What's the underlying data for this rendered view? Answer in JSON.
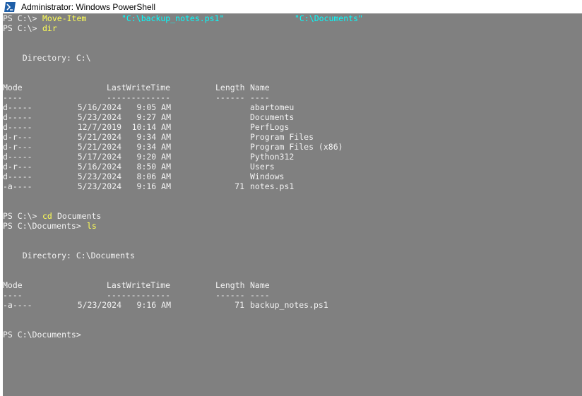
{
  "window": {
    "title": "Administrator: Windows PowerShell",
    "icon": "powershell-icon"
  },
  "colors": {
    "console_bg": "#808080",
    "text": "#f2f2f2",
    "command": "#ffff55",
    "string": "#00ffff"
  },
  "console": {
    "cmd1": {
      "prompt": "PS C:\\> ",
      "command": "Move-Item",
      "arg1": "\"C:\\backup_notes.ps1\"",
      "arg2": "\"C:\\Documents\""
    },
    "cmd2": {
      "prompt": "PS C:\\> ",
      "command": "dir"
    },
    "dir1": {
      "directory_label": "    Directory: C:\\",
      "headers": {
        "mode": "Mode",
        "lastwrite": "LastWriteTime",
        "length": "Length",
        "name": "Name"
      },
      "underline": {
        "mode": "----",
        "lastwrite": "-------------",
        "length": "------",
        "name": "----"
      },
      "rows": [
        {
          "mode": "d-----",
          "date": "5/16/2024",
          "time": "9:05 AM",
          "length": "",
          "name": "abartomeu"
        },
        {
          "mode": "d-----",
          "date": "5/23/2024",
          "time": "9:27 AM",
          "length": "",
          "name": "Documents"
        },
        {
          "mode": "d-----",
          "date": "12/7/2019",
          "time": "10:14 AM",
          "length": "",
          "name": "PerfLogs"
        },
        {
          "mode": "d-r---",
          "date": "5/21/2024",
          "time": "9:34 AM",
          "length": "",
          "name": "Program Files"
        },
        {
          "mode": "d-r---",
          "date": "5/21/2024",
          "time": "9:34 AM",
          "length": "",
          "name": "Program Files (x86)"
        },
        {
          "mode": "d-----",
          "date": "5/17/2024",
          "time": "9:20 AM",
          "length": "",
          "name": "Python312"
        },
        {
          "mode": "d-r---",
          "date": "5/16/2024",
          "time": "8:50 AM",
          "length": "",
          "name": "Users"
        },
        {
          "mode": "d-----",
          "date": "5/23/2024",
          "time": "8:06 AM",
          "length": "",
          "name": "Windows"
        },
        {
          "mode": "-a----",
          "date": "5/23/2024",
          "time": "9:16 AM",
          "length": "71",
          "name": "notes.ps1"
        }
      ]
    },
    "cmd3": {
      "prompt": "PS C:\\> ",
      "command": "cd",
      "arg": "Documents"
    },
    "cmd4": {
      "prompt": "PS C:\\Documents> ",
      "command": "ls"
    },
    "dir2": {
      "directory_label": "    Directory: C:\\Documents",
      "headers": {
        "mode": "Mode",
        "lastwrite": "LastWriteTime",
        "length": "Length",
        "name": "Name"
      },
      "underline": {
        "mode": "----",
        "lastwrite": "-------------",
        "length": "------",
        "name": "----"
      },
      "rows": [
        {
          "mode": "-a----",
          "date": "5/23/2024",
          "time": "9:16 AM",
          "length": "71",
          "name": "backup_notes.ps1"
        }
      ]
    },
    "final_prompt": "PS C:\\Documents> "
  }
}
